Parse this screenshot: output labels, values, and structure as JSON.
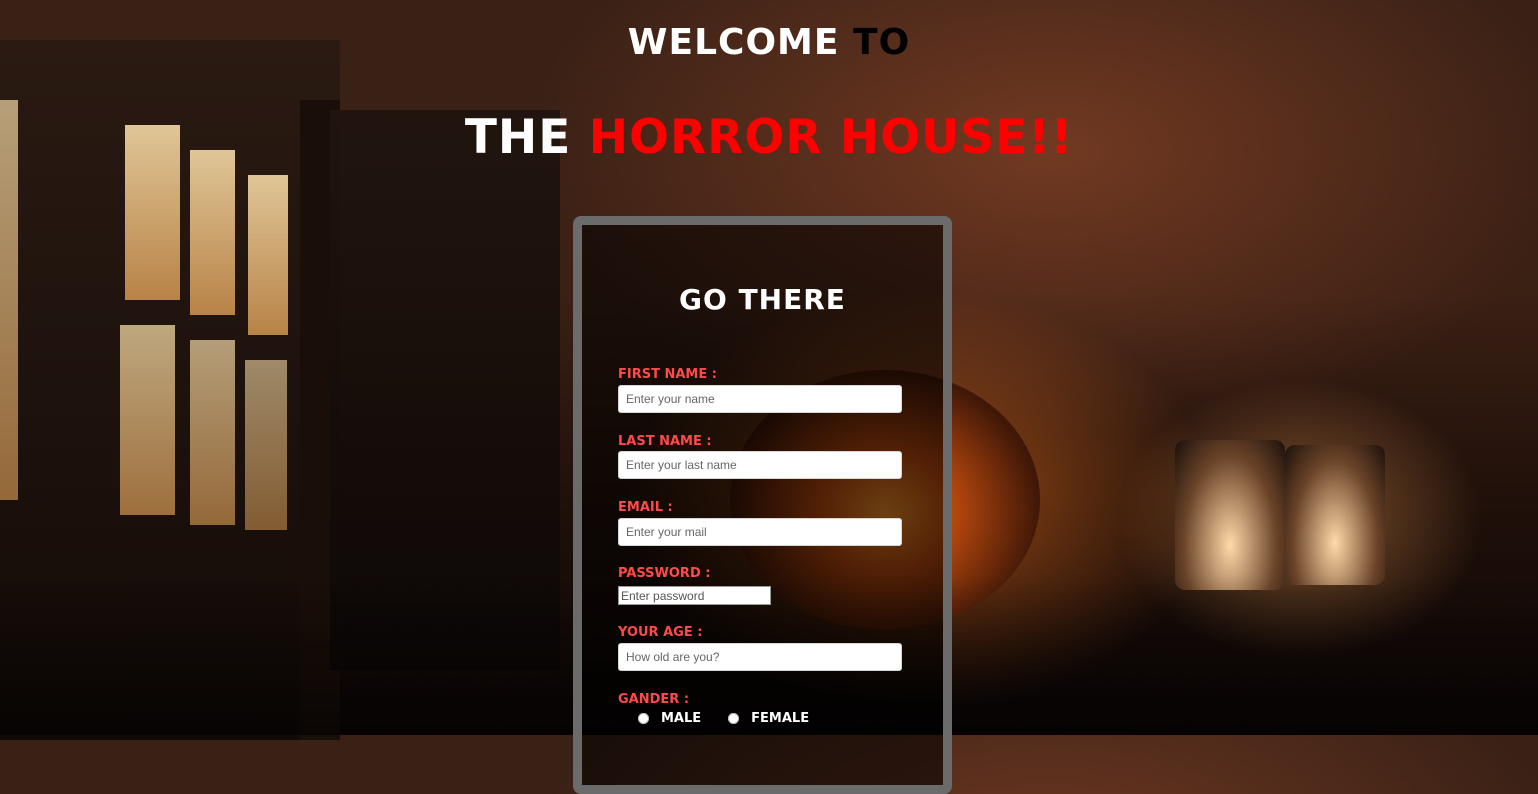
{
  "header": {
    "line1_part1": "WELCOME",
    "line1_part2": "TO",
    "line2_part1": "THE",
    "line2_part2": "HORROR HOUSE!!"
  },
  "form": {
    "heading": "GO THERE",
    "first_name": {
      "label": "FIRST NAME :",
      "placeholder": "Enter your name"
    },
    "last_name": {
      "label": "LAST NAME :",
      "placeholder": "Enter your last name"
    },
    "email": {
      "label": "EMAIL :",
      "placeholder": "Enter your mail"
    },
    "password": {
      "label": "PASSWORD :",
      "placeholder": "Enter password"
    },
    "age": {
      "label": "YOUR AGE :",
      "placeholder": "How old are you?"
    },
    "gender": {
      "label": "GANDER :",
      "options": [
        "MALE",
        "FEMALE"
      ]
    }
  },
  "colors": {
    "title_white": "#ffffff",
    "title_black": "#000000",
    "title_red": "#ff0000",
    "label_red": "#ff4a4a",
    "form_border": "#6b6b6b"
  }
}
